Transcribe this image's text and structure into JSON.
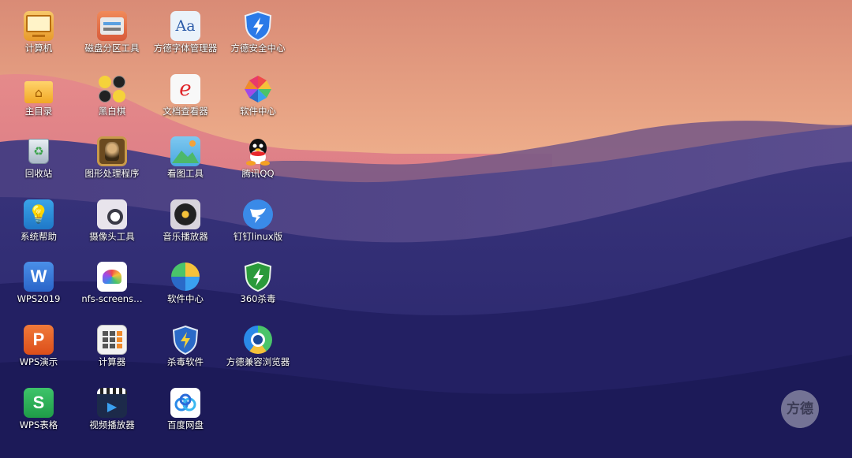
{
  "desktop": {
    "icons": [
      {
        "label": "计算机",
        "icon": "computer-icon"
      },
      {
        "label": "磁盘分区工具",
        "icon": "disk-partition-icon"
      },
      {
        "label": "方德字体管理器",
        "icon": "font-manager-icon"
      },
      {
        "label": "方德安全中心",
        "icon": "security-center-icon"
      },
      {
        "label": "主目录",
        "icon": "home-folder-icon"
      },
      {
        "label": "黑白棋",
        "icon": "reversi-icon"
      },
      {
        "label": "文档查看器",
        "icon": "document-viewer-icon"
      },
      {
        "label": "软件中心",
        "icon": "software-center-icon"
      },
      {
        "label": "回收站",
        "icon": "trash-icon"
      },
      {
        "label": "图形处理程序",
        "icon": "image-editor-icon"
      },
      {
        "label": "看图工具",
        "icon": "image-viewer-icon"
      },
      {
        "label": "腾讯QQ",
        "icon": "qq-icon"
      },
      {
        "label": "系统帮助",
        "icon": "help-icon"
      },
      {
        "label": "摄像头工具",
        "icon": "camera-icon"
      },
      {
        "label": "音乐播放器",
        "icon": "music-player-icon"
      },
      {
        "label": "钉钉linux版",
        "icon": "dingtalk-icon"
      },
      {
        "label": "WPS2019",
        "icon": "wps-writer-icon"
      },
      {
        "label": "nfs-screens…",
        "icon": "nfs-screenshot-icon"
      },
      {
        "label": "软件中心",
        "icon": "software-center-2-icon"
      },
      {
        "label": "360杀毒",
        "icon": "360-antivirus-icon"
      },
      {
        "label": "WPS演示",
        "icon": "wps-presentation-icon"
      },
      {
        "label": "计算器",
        "icon": "calculator-icon"
      },
      {
        "label": "杀毒软件",
        "icon": "antivirus-icon"
      },
      {
        "label": "方德兼容浏览器",
        "icon": "browser-icon"
      },
      {
        "label": "WPS表格",
        "icon": "wps-spreadsheet-icon"
      },
      {
        "label": "视频播放器",
        "icon": "video-player-icon"
      },
      {
        "label": "百度网盘",
        "icon": "baidu-netdisk-icon"
      }
    ],
    "watermark_logo": "方德",
    "colors": {
      "sky_top": "#e9a27f",
      "sky_mid": "#f0b48c",
      "mountain_dark": "#1f1f66"
    }
  }
}
